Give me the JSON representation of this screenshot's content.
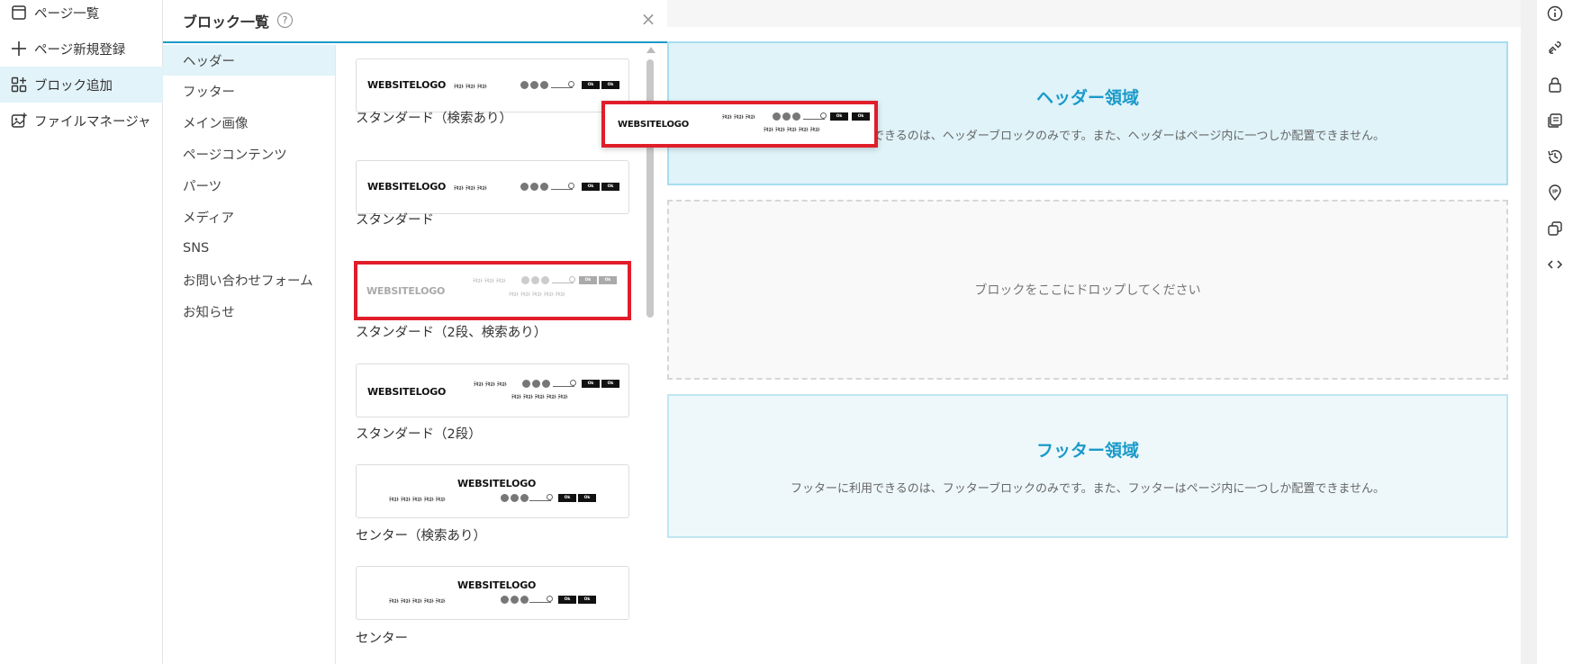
{
  "left_nav": {
    "items": [
      {
        "label": "ページ一覧",
        "icon": "page-list-icon"
      },
      {
        "label": "ページ新規登録",
        "icon": "plus-icon"
      },
      {
        "label": "ブロック追加",
        "icon": "blocks-icon"
      },
      {
        "label": "ファイルマネージャ",
        "icon": "image-add-icon"
      }
    ]
  },
  "panel": {
    "title": "ブロック一覧",
    "help": "?",
    "close": "×",
    "categories": [
      "ヘッダー",
      "フッター",
      "メイン画像",
      "ページコンテンツ",
      "パーツ",
      "メディア",
      "SNS",
      "お問い合わせフォーム",
      "お知らせ"
    ],
    "blocks": [
      {
        "label": "スタンダード（検索あり）"
      },
      {
        "label": "スタンダード"
      },
      {
        "label": "スタンダード（2段、検索あり）"
      },
      {
        "label": "スタンダード（2段）"
      },
      {
        "label": "センター（検索あり）"
      },
      {
        "label": "センター"
      }
    ],
    "mock": {
      "logo": "WEBSITELOGO",
      "nav_text": "ﾃｷｽﾄ",
      "btn": "Ok"
    }
  },
  "canvas": {
    "header_zone": {
      "title": "ヘッダー領域",
      "desc": "ヘッダーに利用できるのは、ヘッダーブロックのみです。また、ヘッダーはページ内に一つしか配置できません。"
    },
    "drop_zone": {
      "text": "ブロックをここにドロップしてください"
    },
    "footer_zone": {
      "title": "フッター領域",
      "desc": "フッターに利用できるのは、フッターブロックのみです。また、フッターはページ内に一つしか配置できません。"
    }
  },
  "right_toolbar": [
    "info-icon",
    "link-icon",
    "lock-icon",
    "copy-page-icon",
    "history-icon",
    "ip-icon",
    "duplicate-icon",
    "code-icon"
  ],
  "colors": {
    "accent": "#1a9ac9",
    "highlight": "#e11d2a"
  }
}
